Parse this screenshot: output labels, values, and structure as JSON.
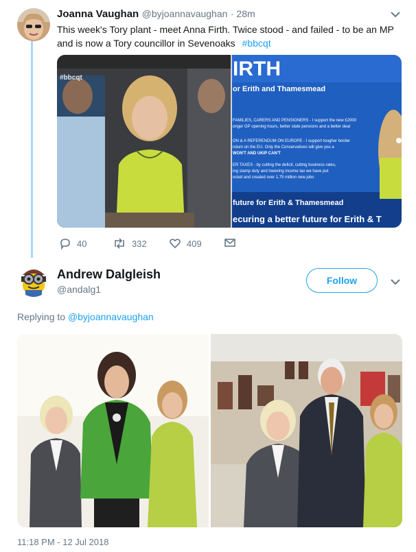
{
  "tweet1": {
    "name": "Joanna Vaughan",
    "handle": "@byjoannavaughan",
    "time": "· 28m",
    "text_line1": "This week's Tory plant - meet Anna Firth. Twice stood - and failed - to be an MP",
    "text_line2": "and is now a Tory councillor in Sevenoaks",
    "hashtag": "#bbcqt",
    "media_tv_tag": "#bbcqt",
    "leaflet": {
      "title": "IRTH",
      "subtitle": "or Erith and Thamesmead",
      "p1": "FAMILIES, CARERS AND PENSIONERS - I support the new £2000",
      "p1b": "onger GP opening hours, better state pensions and a better deal",
      "p2": "ON & A REFERENDUM ON EUROPE - I support tougher border",
      "p2b": "ndum on the EU. Only the Conservatives will give you a",
      "p2c": "WON'T AND UKIP CAN'T",
      "p3": "ER TAXES - by cutting the deficit, cutting business rates,",
      "p3b": "ing stamp duty and lowering income tax we have put",
      "p3c": "ocket and created over 1.75 million new jobs",
      "banner1": "future for Erith & Thamesmead",
      "banner2": "ecuring a better future for Erith & T"
    },
    "replies": "40",
    "retweets": "332",
    "likes": "409"
  },
  "tweet2": {
    "name": "Andrew Dalgleish",
    "handle": "@andalg1",
    "follow_label": "Follow",
    "replying_prefix": "Replying to",
    "replying_to": "@byjoannavaughan",
    "timestamp": "11:18 PM - 12 Jul 2018"
  },
  "icons": {
    "reply": "reply-icon",
    "retweet": "retweet-icon",
    "like": "heart-icon",
    "dm": "envelope-icon",
    "more": "chevron-down-icon"
  },
  "colors": {
    "accent": "#1da1f2",
    "muted": "#657786",
    "thread": "#a8d8f8"
  }
}
